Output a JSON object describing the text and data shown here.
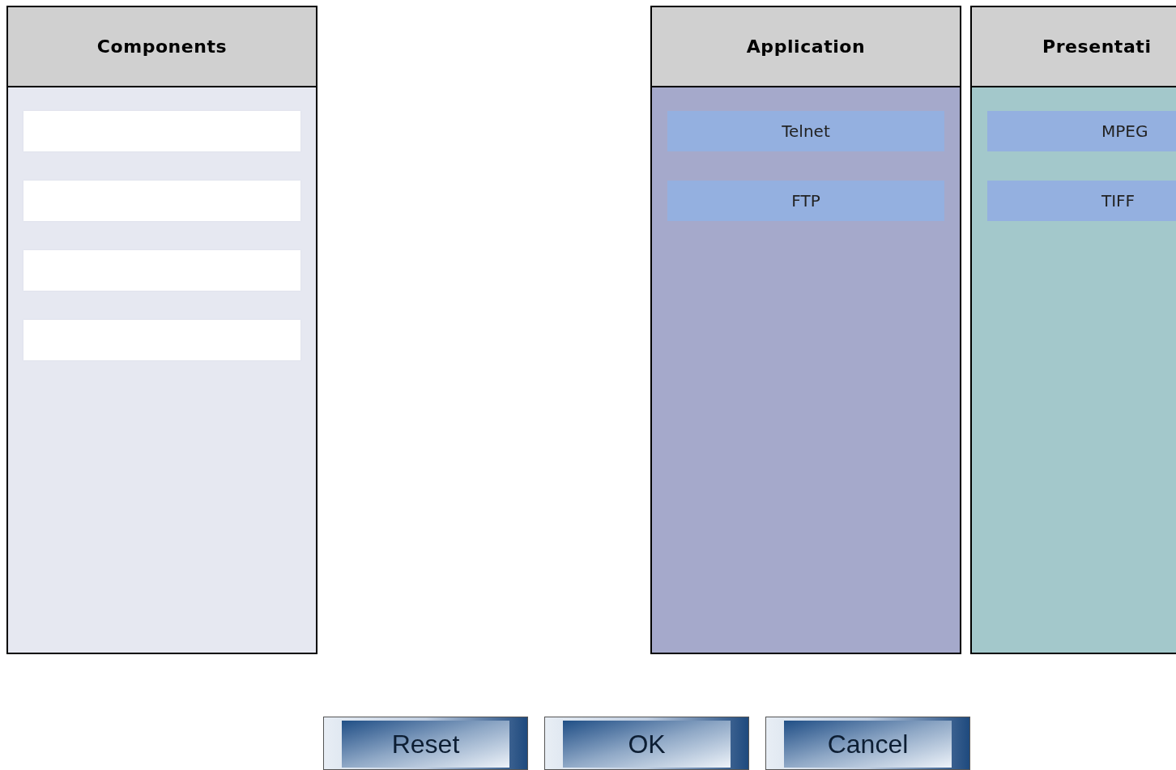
{
  "panels": [
    {
      "title": "Components",
      "kind": "source",
      "items": [
        {
          "kind": "empty"
        },
        {
          "kind": "empty"
        },
        {
          "kind": "empty"
        },
        {
          "kind": "empty"
        }
      ]
    },
    {
      "title": "Application",
      "kind": "application",
      "items": [
        {
          "kind": "tag",
          "label": "Telnet"
        },
        {
          "kind": "tag",
          "label": "FTP"
        }
      ]
    },
    {
      "title": "Presentati",
      "kind": "presentation",
      "items": [
        {
          "kind": "tag",
          "label": "MPEG"
        },
        {
          "kind": "tag",
          "label": "TIFF"
        }
      ]
    }
  ],
  "buttons": [
    "Reset",
    "OK",
    "Cancel"
  ]
}
